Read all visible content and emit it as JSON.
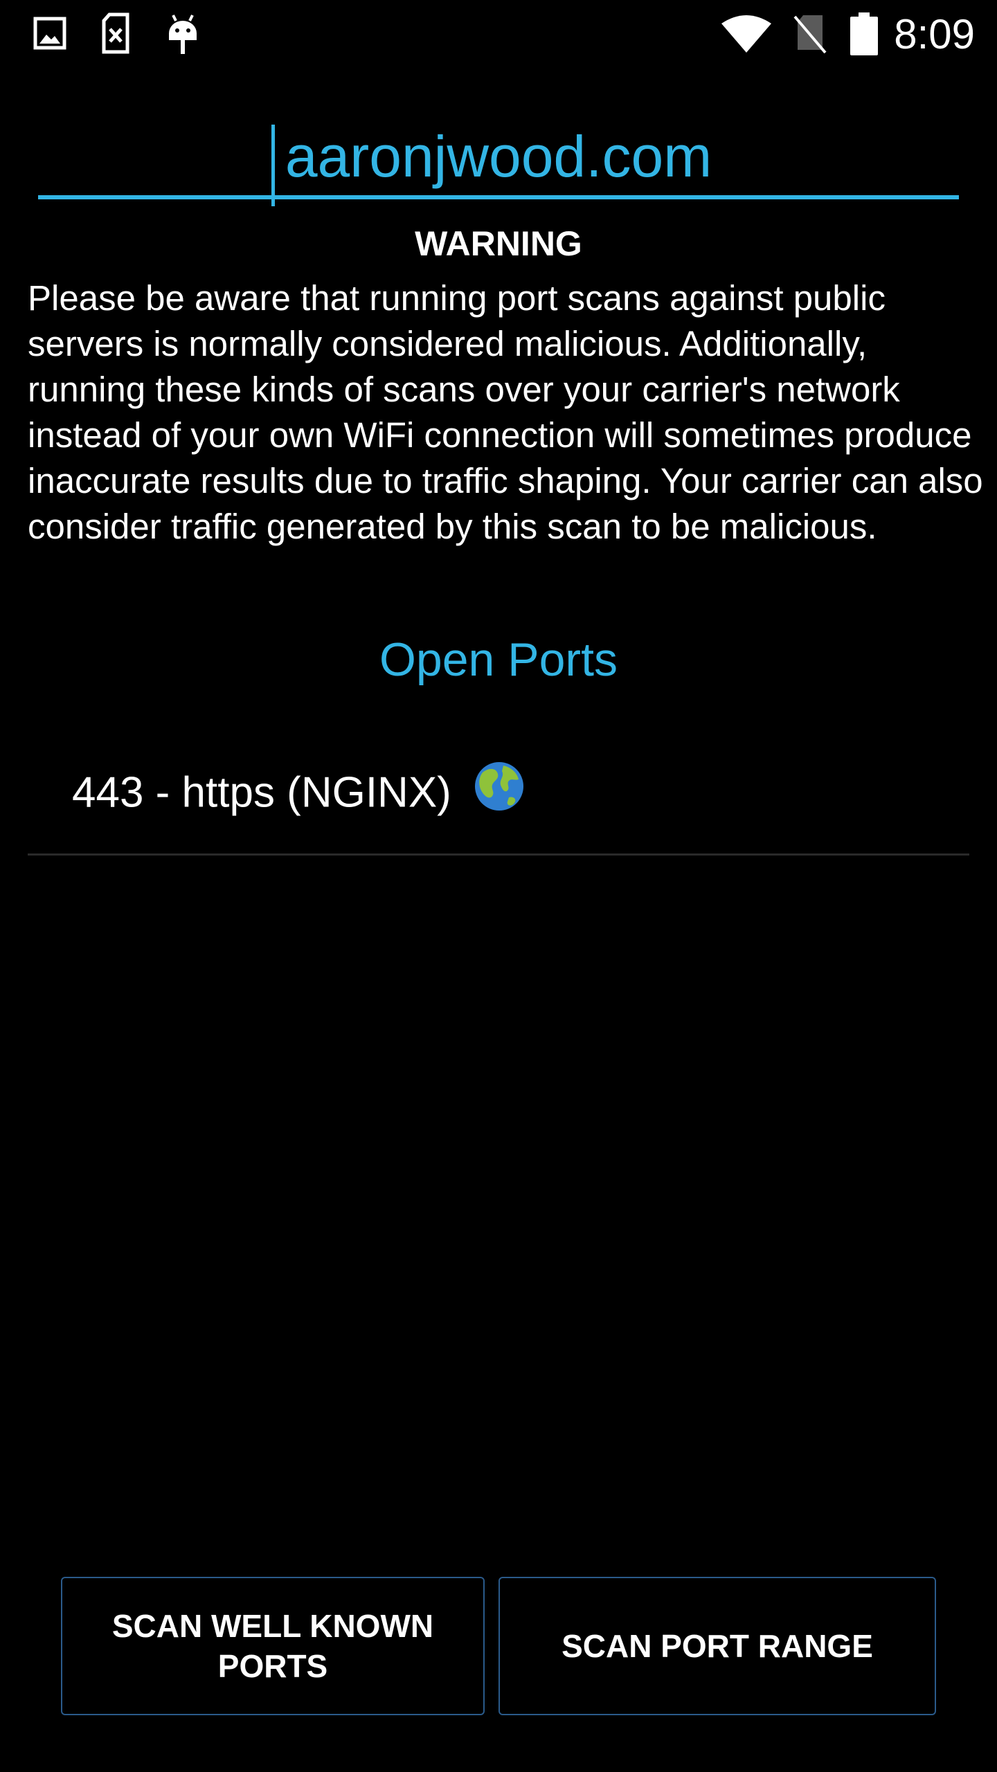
{
  "status_bar": {
    "time": "8:09",
    "left_icons": [
      "image-icon",
      "sim-error-icon",
      "android-debug-icon"
    ],
    "right_icons": [
      "wifi-icon",
      "no-sim-icon",
      "battery-icon"
    ]
  },
  "host": {
    "value": "aaronjwood.com",
    "accent_color": "#33b5e5"
  },
  "warning": {
    "title": "WARNING",
    "body": "Please be aware that running port scans against public servers is normally considered malicious. Additionally, running these kinds of scans over your carrier's network instead of your own WiFi connection will sometimes produce inaccurate results due to traffic shaping. Your carrier can also consider traffic generated by this scan to be malicious."
  },
  "ports": {
    "heading": "Open Ports",
    "items": [
      {
        "label": "443 - https (NGINX)",
        "icon": "globe-icon"
      }
    ]
  },
  "buttons": {
    "scan_well_known": "SCAN WELL KNOWN PORTS",
    "scan_range": "SCAN PORT RANGE"
  }
}
